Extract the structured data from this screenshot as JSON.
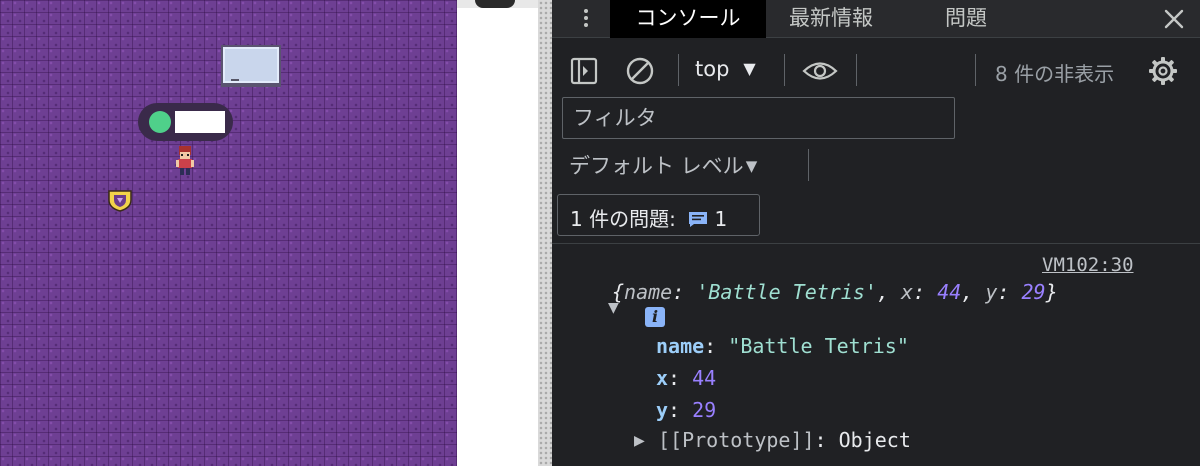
{
  "devtools": {
    "tabs": [
      {
        "label": "コンソール",
        "active": true
      },
      {
        "label": "最新情報",
        "active": false
      },
      {
        "label": "問題",
        "active": false
      }
    ],
    "toolbar": {
      "context": "top",
      "hidden_count": "8 件の非表示"
    },
    "filter": {
      "placeholder": "フィルタ"
    },
    "levels": {
      "label": "デフォルト レベル"
    },
    "issues": {
      "label": "1 件の問題:",
      "count": "1"
    },
    "console": {
      "source": "VM102:30",
      "object": {
        "name": "Battle Tetris",
        "x": "44",
        "y": "29"
      },
      "prototype_label": "[[Prototype]]",
      "prototype_value": "Object"
    }
  },
  "colors": {
    "game_floor": "#6e3f93",
    "status_dot": "#4fd08a",
    "devtools_bg": "#202124",
    "accent_blue": "#8ab4f8",
    "number_purple": "#9980ff",
    "string_teal": "#9fdfd1"
  }
}
